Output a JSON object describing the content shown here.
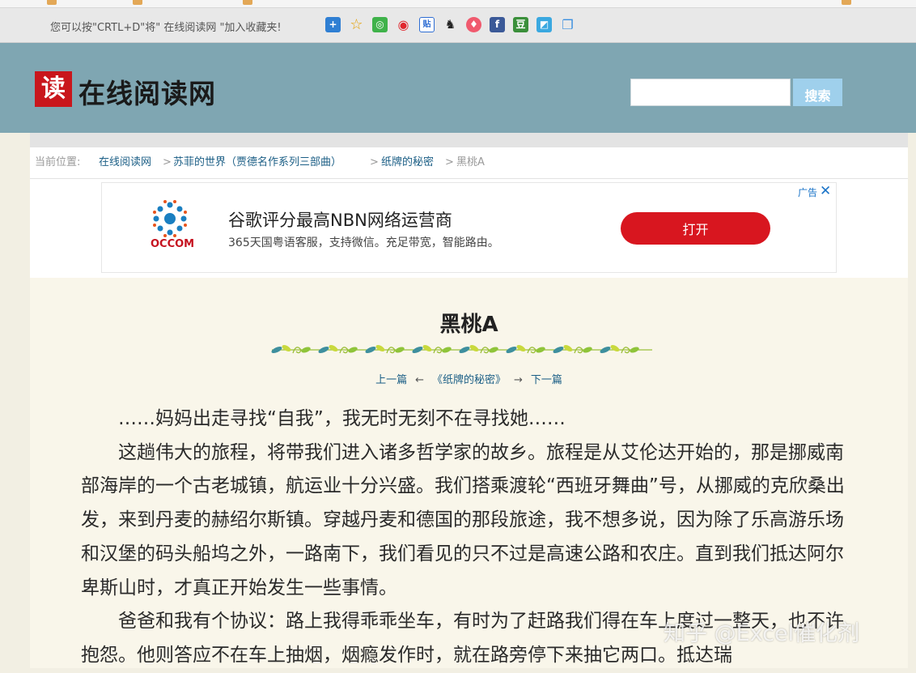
{
  "notice_bar": {
    "text": "您可以按\"CRTL+D\"将\" 在线阅读网 \"加入收藏夹!",
    "share_icons": [
      "plus-icon",
      "star-icon",
      "wechat-icon",
      "weibo-icon",
      "tieba-icon",
      "qq-icon",
      "renren-icon",
      "facebook-icon",
      "douban-icon",
      "kaixin-icon",
      "copy-icon"
    ]
  },
  "header": {
    "logo_char": "读",
    "site_name": "在线阅读网",
    "search_placeholder": "",
    "search_button": "搜索"
  },
  "breadcrumb": {
    "prefix": "当前位置:",
    "sep": ">",
    "items": [
      "在线阅读网",
      "苏菲的世界（贾德名作系列三部曲）",
      "纸牌的秘密",
      "黑桃A"
    ]
  },
  "ad": {
    "brand": "OCCOM",
    "title": "谷歌评分最高NBN网络运营商",
    "desc": "365天国粤语客服，支持微信。充足带宽，智能路由。",
    "button": "打开",
    "tag": "广告",
    "close": "✕"
  },
  "article": {
    "title": "黑桃A",
    "nav_prev": "上一篇",
    "nav_book": "《纸牌的秘密》",
    "nav_next": "下一篇",
    "arrow_left": "←",
    "arrow_right": "→",
    "paragraphs": [
      "……妈妈出走寻找“自我”，我无时无刻不在寻找她……",
      "这趟伟大的旅程，将带我们进入诸多哲学家的故乡。旅程是从艾伦达开始的，那是挪威南部海岸的一个古老城镇，航运业十分兴盛。我们搭乘渡轮“西班牙舞曲”号，从挪威的克欣桑出发，来到丹麦的赫绍尔斯镇。穿越丹麦和德国的那段旅途，我不想多说，因为除了乐高游乐场和汉堡的码头船坞之外，一路南下，我们看见的只不过是高速公路和农庄。直到我们抵达阿尔卑斯山时，才真正开始发生一些事情。",
      "爸爸和我有个协议：路上我得乖乖坐车，有时为了赶路我们得在车上度过一整天，也不许抱怨。他则答应不在车上抽烟，烟瘾发作时，就在路旁停下来抽它两口。抵达瑞"
    ]
  },
  "watermark": "知乎 @Excel催化剂",
  "colors": {
    "header_bg": "#7fa6b2",
    "page_bg": "#f9f6ea",
    "link": "#1c5f86",
    "ad_button": "#d8161f",
    "logo_red": "#c9161c"
  }
}
